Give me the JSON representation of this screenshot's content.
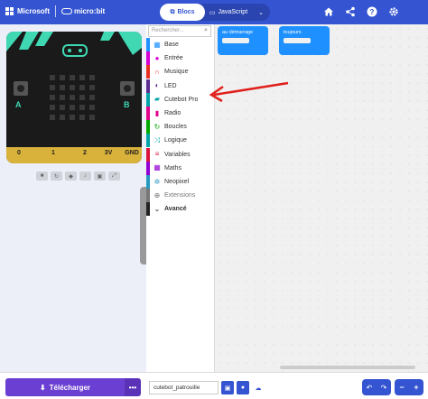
{
  "header": {
    "brand": "Microsoft",
    "product": "micro:bit",
    "tabs": [
      {
        "label": "Blocs",
        "icon": "puzzle-icon"
      },
      {
        "label": "JavaScript",
        "icon": "code-icon"
      }
    ],
    "icons": [
      "home-icon",
      "share-icon",
      "help-icon",
      "gear-icon"
    ],
    "color": "#3454d1"
  },
  "simulator": {
    "button_labels": [
      "A",
      "B"
    ],
    "pins": [
      "0",
      "1",
      "2",
      "3V",
      "GND"
    ]
  },
  "toolbox": {
    "search_placeholder": "Rechercher...",
    "categories": [
      {
        "label": "Base",
        "color": "#1e90ff",
        "icon": "grid-icon"
      },
      {
        "label": "Entrée",
        "color": "#d400d4",
        "icon": "circle-icon"
      },
      {
        "label": "Musique",
        "color": "#e63022",
        "icon": "headphones-icon"
      },
      {
        "label": "LED",
        "color": "#5c2d91",
        "icon": "toggle-icon"
      },
      {
        "label": "Cutebot Pro",
        "color": "#00a4a6",
        "icon": "car-icon"
      },
      {
        "label": "Radio",
        "color": "#e3008c",
        "icon": "signal-icon"
      },
      {
        "label": "Boucles",
        "color": "#00aa00",
        "icon": "loop-icon"
      },
      {
        "label": "Logique",
        "color": "#00a4a6",
        "icon": "shuffle-icon"
      },
      {
        "label": "Variables",
        "color": "#dc143c",
        "icon": "list-icon"
      },
      {
        "label": "Maths",
        "color": "#9400d3",
        "icon": "calculator-icon"
      },
      {
        "label": "Neopixel",
        "color": "#2699bf",
        "icon": "spinner-icon"
      },
      {
        "label": "Extensions",
        "color": "#777777",
        "icon": "plus-circle-icon"
      },
      {
        "label": "Avancé",
        "color": "#222222",
        "icon": "chevron-down-icon"
      }
    ]
  },
  "workspace": {
    "blocks": [
      {
        "label": "au démarrage"
      },
      {
        "label": "toujours"
      }
    ]
  },
  "footer": {
    "download_label": "Télécharger",
    "more_label": "•••",
    "project_name": "cutebot_patrouille"
  }
}
